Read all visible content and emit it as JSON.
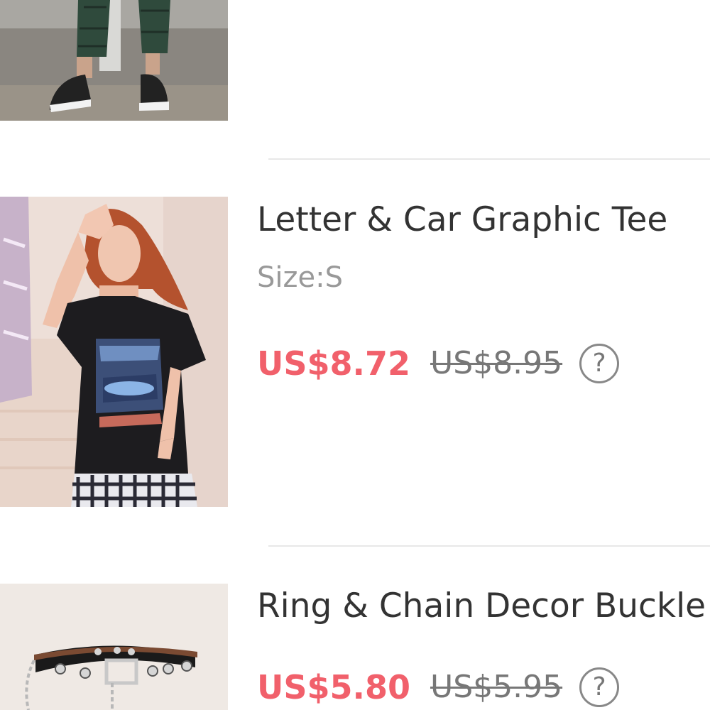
{
  "products": [
    {
      "title": "Letter & Car Graphic Tee",
      "size": "Size:S",
      "price": "US$8.72",
      "original_price": "US$8.95",
      "help_icon": "question-circle-icon",
      "help_glyph": "?"
    },
    {
      "title": "Ring & Chain Decor Buckle",
      "price": "US$5.80",
      "original_price": "US$5.95",
      "help_icon": "question-circle-icon",
      "help_glyph": "?"
    }
  ],
  "colors": {
    "sale_price": "#f1606b",
    "divider": "#e8e8e8"
  }
}
